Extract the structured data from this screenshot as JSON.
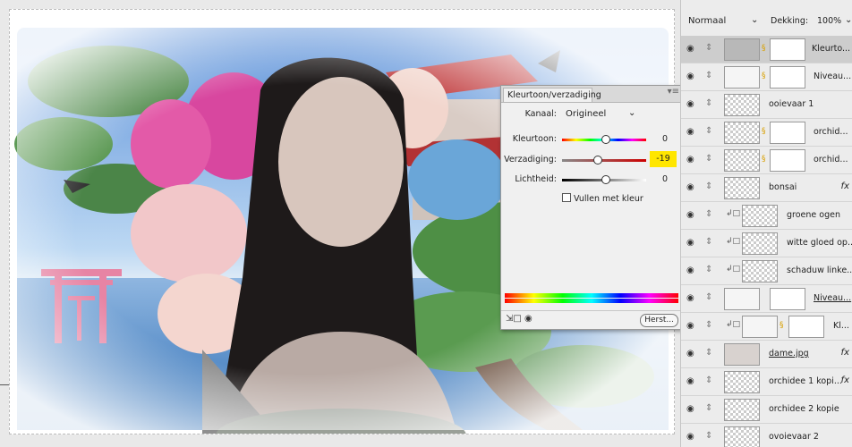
{
  "properties": {
    "tab": "Kleurtoon/verzadiging",
    "menu_icon": "panel-menu-icon",
    "channel_label": "Kanaal:",
    "channel_value": "Origineel",
    "hue_label": "Kleurtoon:",
    "hue_value": "0",
    "saturation_label": "Verzadiging:",
    "saturation_value": "-19",
    "lightness_label": "Lichtheid:",
    "lightness_value": "0",
    "colorize_label": "Vullen met kleur",
    "reset_label": "Herst...",
    "highlight_color": "#ffe600"
  },
  "layers_panel": {
    "blend_mode": "Normaal",
    "opacity_label": "Dekking:",
    "opacity_value": "100%",
    "layers": [
      {
        "name": "Kleurto..."
      },
      {
        "name": "Niveau..."
      },
      {
        "name": "ooievaar 1"
      },
      {
        "name": "orchid..."
      },
      {
        "name": "orchid..."
      },
      {
        "name": "bonsai",
        "fx": "fx"
      },
      {
        "name": "groene ogen"
      },
      {
        "name": "witte gloed op..."
      },
      {
        "name": "schaduw linke..."
      },
      {
        "name": "Niveau..."
      },
      {
        "name": "Kl..."
      },
      {
        "name": "dame.jpg",
        "fx": "fx"
      },
      {
        "name": "orchidee 1 kopi...",
        "fx": "fx"
      },
      {
        "name": "orchidee 2 kopie"
      },
      {
        "name": "ovoievaar 2"
      }
    ]
  }
}
